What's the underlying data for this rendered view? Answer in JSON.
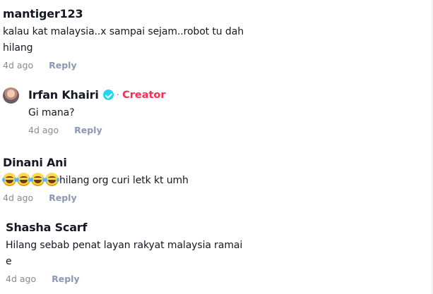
{
  "comments": [
    {
      "username": "mantiger123",
      "text_line1": "kalau kat malaysia..x sampai sejam..robot tu dah",
      "text_line2": "hilang",
      "time": "4d ago",
      "reply_label": "Reply"
    },
    {
      "username": "Irfan Khairi",
      "separator": "·",
      "badge": "Creator",
      "text_line1": "Gi mana?",
      "time": "4d ago",
      "reply_label": "Reply"
    },
    {
      "username": "Dinani Ani",
      "text_line1": "hilang org curi letk kt umh",
      "emoji_count": 4,
      "emoji_name": "face-with-tears-of-joy",
      "time": "4d ago",
      "reply_label": "Reply"
    },
    {
      "username": "Shasha Scarf",
      "text_line1": "Hilang sebab penat layan rakyat malaysia ramai",
      "text_line2": "e",
      "time": "4d ago",
      "reply_label": "Reply"
    }
  ],
  "colors": {
    "creator": "#fe2c55",
    "verified": "#20d5ec",
    "meta": "#8a8b91"
  }
}
